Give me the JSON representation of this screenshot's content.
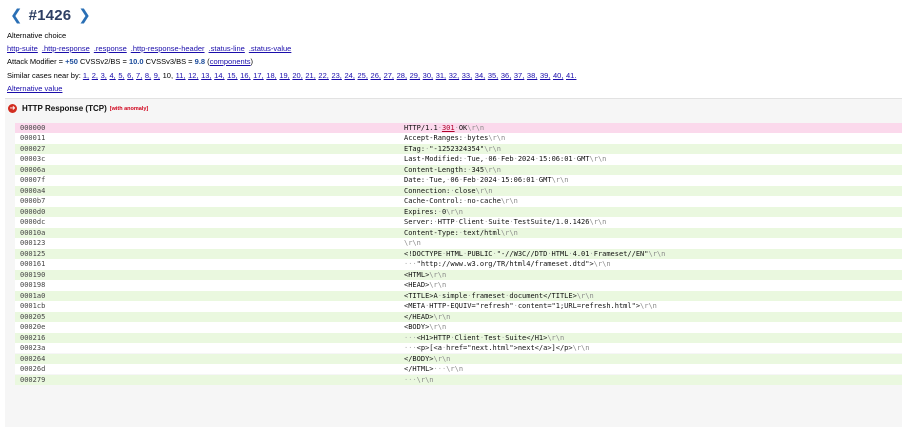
{
  "header": {
    "case_number": "#1426",
    "prev_icon": "chevron-left-icon",
    "next_icon": "chevron-right-icon"
  },
  "alternative_choice_label": "Alternative choice",
  "tags": [
    "http-suite",
    ".http-response",
    ".response",
    ".http-response-header",
    ".status-line",
    ".status-value"
  ],
  "attack": {
    "prefix": "Attack Modifier = ",
    "modifier": "+50",
    "cvss2_label": " CVSSv2/BS = ",
    "cvss2_value": "10.0",
    "cvss3_label": " CVSSv3/BS = ",
    "cvss3_value": "9.8",
    "components_open": " (",
    "components_link": "components",
    "components_close": ")"
  },
  "similar": {
    "label": "Similar cases near by: ",
    "before": [
      "1,",
      "2,",
      "3,",
      "4,",
      "5,",
      "6,",
      "7,",
      "8,",
      "9,"
    ],
    "current": "10,",
    "after": [
      "11,",
      "12,",
      "13,",
      "14,",
      "15,",
      "16,",
      "17,",
      "18,",
      "19,",
      "20,",
      "21,",
      "22,",
      "23,",
      "24,",
      "25,",
      "26,",
      "27,",
      "28,",
      "29,",
      "30,",
      "31,",
      "32,",
      "33,",
      "34,",
      "35,",
      "36,",
      "37,",
      "38,",
      "39,",
      "40,",
      "41."
    ]
  },
  "alternative_value_link": "Alternative value",
  "panel": {
    "icon": "arrow-right-circle-icon",
    "title": "HTTP Response (TCP)",
    "badge": "[with anomaly]"
  },
  "rows": [
    {
      "offset": "000000",
      "data": "HTTP/1.1·301·OK\\r\\n"
    },
    {
      "offset": "000011",
      "data": "Accept-Ranges:·bytes\\r\\n"
    },
    {
      "offset": "000027",
      "data": "ETag:·\"-1252324354\"\\r\\n"
    },
    {
      "offset": "00003c",
      "data": "Last-Modified:·Tue,·06·Feb·2024·15:06:01·GMT\\r\\n"
    },
    {
      "offset": "00006a",
      "data": "Content-Length:·345\\r\\n"
    },
    {
      "offset": "00007f",
      "data": "Date:·Tue,·06·Feb·2024·15:06:01·GMT\\r\\n"
    },
    {
      "offset": "0000a4",
      "data": "Connection:·close\\r\\n"
    },
    {
      "offset": "0000b7",
      "data": "Cache-Control:·no-cache\\r\\n"
    },
    {
      "offset": "0000d0",
      "data": "Expires:·0\\r\\n"
    },
    {
      "offset": "0000dc",
      "data": "Server:·HTTP·Client·Suite·TestSuite/1.0.1426\\r\\n"
    },
    {
      "offset": "00010a",
      "data": "Content-Type:·text/html\\r\\n"
    },
    {
      "offset": "000123",
      "data": "\\r\\n"
    },
    {
      "offset": "000125",
      "data": "<!DOCTYPE·HTML·PUBLIC·\"-//W3C//DTD·HTML·4.01·Frameset//EN\"\\r\\n"
    },
    {
      "offset": "000161",
      "data": "···\"http://www.w3.org/TR/html4/frameset.dtd\">\\r\\n"
    },
    {
      "offset": "000190",
      "data": "<HTML>\\r\\n"
    },
    {
      "offset": "000198",
      "data": "<HEAD>\\r\\n"
    },
    {
      "offset": "0001a0",
      "data": "<TITLE>A·simple·frameset·document</TITLE>\\r\\n"
    },
    {
      "offset": "0001cb",
      "data": "<META·HTTP-EQUIV=\"refresh\"·content=\"1;URL=refresh.html\">\\r\\n"
    },
    {
      "offset": "000205",
      "data": "</HEAD>\\r\\n"
    },
    {
      "offset": "00020e",
      "data": "<BODY>\\r\\n"
    },
    {
      "offset": "000216",
      "data": "···<H1>HTTP·Client·Test·Suite</H1>\\r\\n"
    },
    {
      "offset": "00023a",
      "data": "···<p>[<a·href=\"next.html\">next</a>]</p>\\r\\n"
    },
    {
      "offset": "000264",
      "data": "</BODY>\\r\\n"
    },
    {
      "offset": "00026d",
      "data": "</HTML>···\\r\\n"
    },
    {
      "offset": "000279",
      "data": "···\\r\\n"
    }
  ],
  "colors": {
    "title": "#2e3f63",
    "chevron": "#2a6fb5",
    "link": "#1a0dab",
    "highlight_row": "#fbd9ec",
    "green_row": "#eaf8df",
    "anomaly": "#d0021b"
  }
}
